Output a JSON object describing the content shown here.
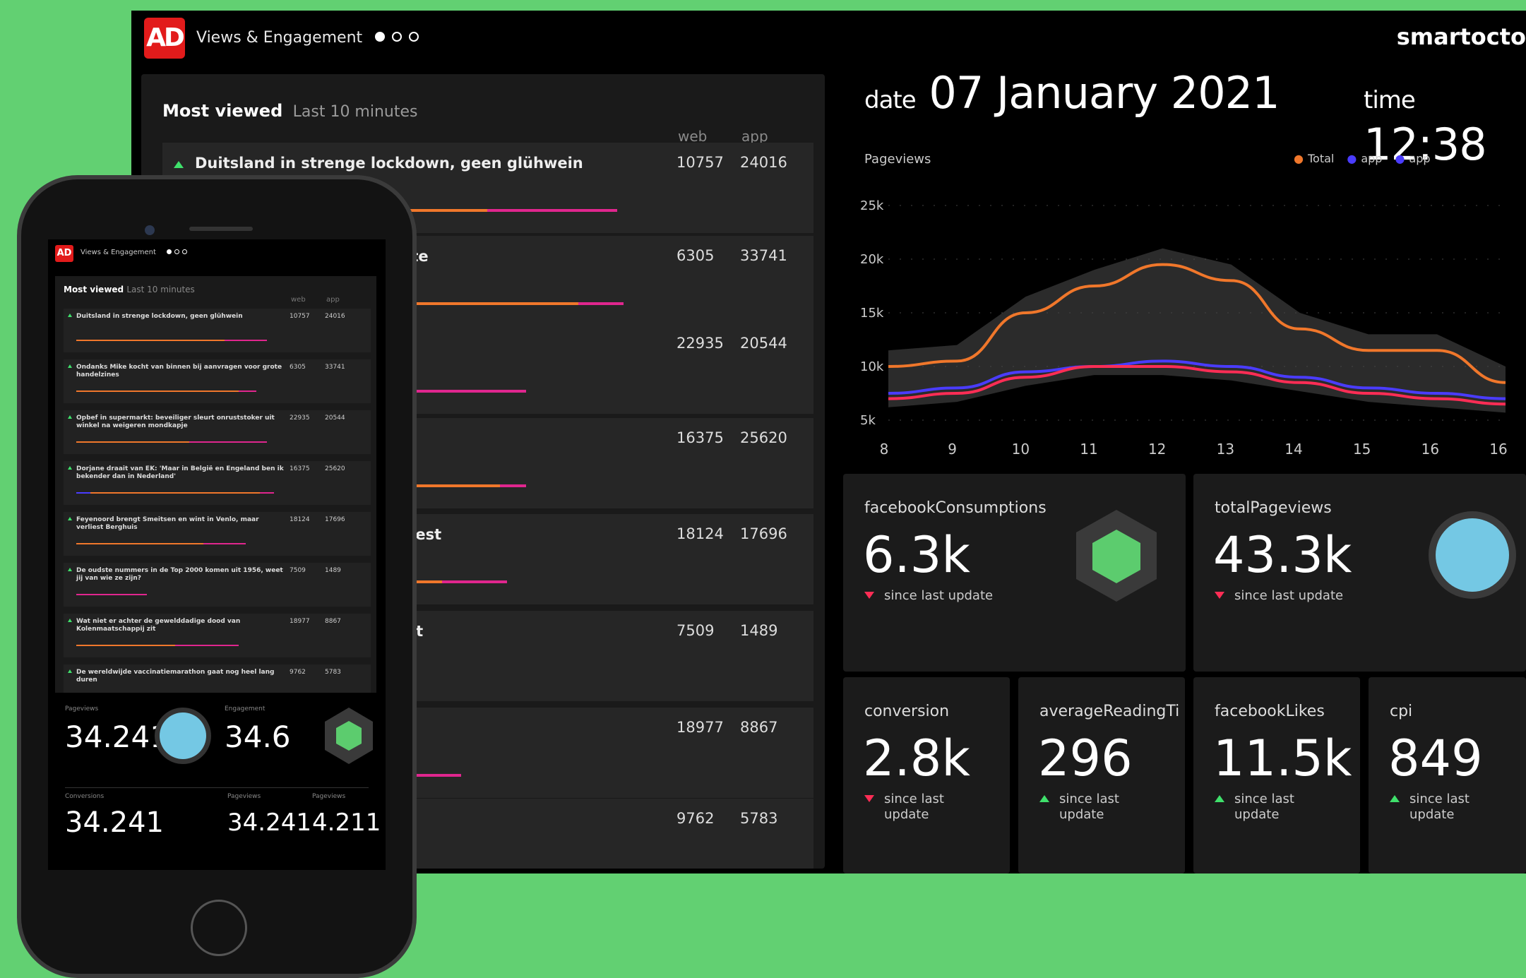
{
  "dashboard": {
    "logo": "AD",
    "title": "Views & Engagement",
    "brand": "smartocto",
    "most_viewed": {
      "title": "Most viewed",
      "subtitle": "Last 10 minutes",
      "col_web": "web",
      "col_app": "app",
      "articles": [
        {
          "title": "Duitsland in strenge lockdown, geen glühwein",
          "web": "10757",
          "app": "24016",
          "bar": [
            0,
            45,
            20
          ]
        },
        {
          "title": "en bij aanvragen voor grote",
          "web": "6305",
          "app": "33741",
          "bar": [
            12,
            47,
            7
          ]
        },
        {
          "title": "er sleurt onruststoker uit",
          "title2": "e",
          "web": "22935",
          "app": "20544",
          "bar": [
            0,
            34,
            17
          ]
        },
        {
          "title": "ar in België en Engeland",
          "title2": "land'",
          "web": "16375",
          "app": "25620",
          "bar": [
            3,
            44,
            4
          ]
        },
        {
          "title": "n wint in Venlo, maar verliest",
          "web": "18124",
          "app": "17696",
          "bar": [
            0,
            38,
            10
          ]
        },
        {
          "title": "2000 komen uit 1956, weet",
          "web": "7509",
          "app": "1489",
          "bar": [
            0,
            0,
            20
          ]
        },
        {
          "title": "adige dood van",
          "web": "18977",
          "app": "8867",
          "bar": [
            0,
            28,
            13
          ]
        },
        {
          "title": "rathon gaat nog heel lang",
          "web": "9762",
          "app": "5783",
          "bar": [
            0,
            0,
            0
          ]
        }
      ]
    },
    "date_label": "date",
    "date_value": "07 January 2021",
    "time_label": "time",
    "time_value": "12:38",
    "chart_data": {
      "type": "line",
      "title": "Pageviews",
      "x": [
        8,
        9,
        10,
        11,
        12,
        13,
        14,
        15,
        16,
        16
      ],
      "xlabels": [
        "8",
        "9",
        "10",
        "11",
        "12",
        "13",
        "14",
        "15",
        "16",
        "16"
      ],
      "yticks": [
        "25k",
        "20k",
        "15k",
        "10k",
        "5k"
      ],
      "ylim": [
        5000,
        25000
      ],
      "series": [
        {
          "name": "Total",
          "color": "#f0772b",
          "values": [
            10000,
            10500,
            15000,
            17500,
            19500,
            18000,
            13500,
            11500,
            11500,
            8500
          ]
        },
        {
          "name": "app",
          "color": "#4a3cff",
          "values": [
            7500,
            8000,
            9500,
            10000,
            10500,
            10000,
            9000,
            8000,
            7500,
            7000
          ]
        },
        {
          "name": "app",
          "color": "#ff2d55",
          "values": [
            7000,
            7500,
            9000,
            10000,
            10000,
            9500,
            8500,
            7500,
            7000,
            6500
          ]
        }
      ],
      "legend": [
        "Total",
        "app",
        "app"
      ],
      "grid": true
    },
    "cards": {
      "facebook": {
        "label": "facebookConsumptions",
        "value": "6.3k",
        "update": "since last update",
        "trend": "down"
      },
      "total": {
        "label": "totalPageviews",
        "value": "43.3k",
        "update": "since last update",
        "trend": "down"
      },
      "conversion": {
        "label": "conversion",
        "value": "2.8k",
        "update": "since last update",
        "trend": "down"
      },
      "reading": {
        "label": "averageReadingTi",
        "value": "296",
        "update": "since last update",
        "trend": "up"
      },
      "likes": {
        "label": "facebookLikes",
        "value": "11.5k",
        "update": "since last update",
        "trend": "up"
      },
      "cpi": {
        "label": "cpi",
        "value": "849",
        "update": "since last update",
        "trend": "up"
      }
    }
  },
  "phone": {
    "logo": "AD",
    "title": "Views & Engagement",
    "list_title": "Most viewed",
    "list_subtitle": "Last 10 minutes",
    "col_web": "web",
    "col_app": "app",
    "articles": [
      {
        "title": "Duitsland in strenge lockdown, geen glühwein",
        "web": "10757",
        "app": "24016"
      },
      {
        "title": "Ondanks Mike kocht van binnen bij aanvragen voor grote handelzines",
        "web": "6305",
        "app": "33741"
      },
      {
        "title": "Opbef in supermarkt: beveiliger sleurt onruststoker uit winkel na weigeren mondkapje",
        "web": "22935",
        "app": "20544"
      },
      {
        "title": "Dorjane draait van EK: 'Maar in België en Engeland ben ik bekender dan in Nederland'",
        "web": "16375",
        "app": "25620"
      },
      {
        "title": "Feyenoord brengt Smeitsen en wint in Venlo, maar verliest Berghuis",
        "web": "18124",
        "app": "17696"
      },
      {
        "title": "De oudste nummers in de Top 2000 komen uit 1956, weet jij van wie ze zijn?",
        "web": "7509",
        "app": "1489"
      },
      {
        "title": "Wat niet er achter de gewelddadige dood van Kolenmaatschappij zit",
        "web": "18977",
        "app": "8867"
      },
      {
        "title": "De wereldwijde vaccinatiemarathon gaat nog heel lang duren",
        "web": "9762",
        "app": "5783"
      }
    ],
    "m1_label": "Pageviews",
    "m1_value": "34.241",
    "m2_label": "Engagement",
    "m2_value": "34.6",
    "m3_label": "Conversions",
    "m3_value": "34.241",
    "m4_label": "Pageviews",
    "m4_value": "34.241",
    "m5_label": "Pageviews",
    "m5_value": "4.211"
  }
}
